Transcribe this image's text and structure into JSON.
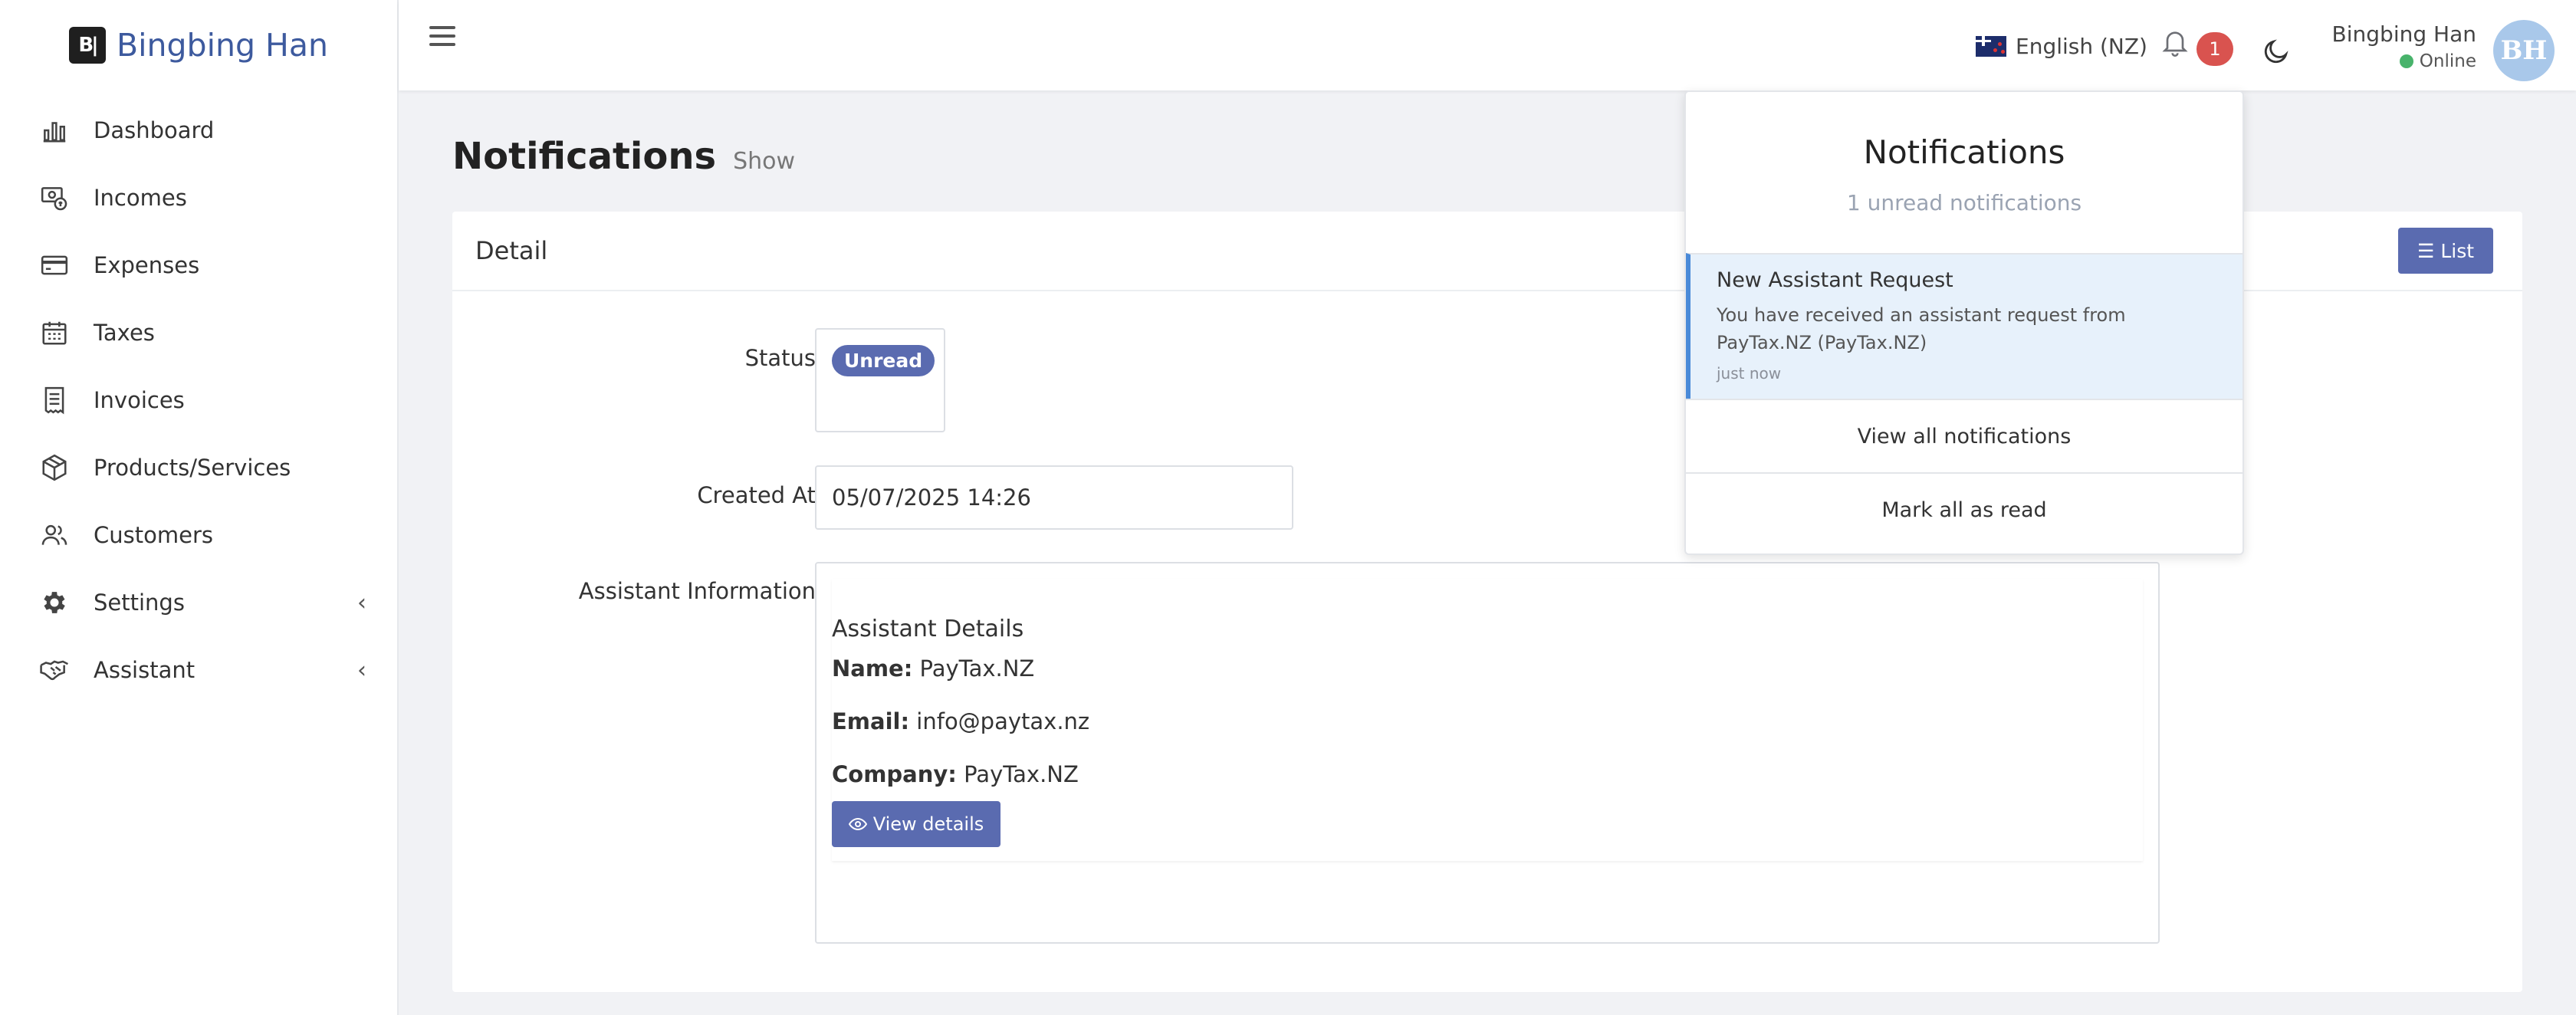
{
  "brand": {
    "name": "Bingbing Han",
    "logo_text": "B|"
  },
  "sidebar": {
    "items": [
      {
        "label": "Dashboard",
        "icon": "bar-chart-icon"
      },
      {
        "label": "Incomes",
        "icon": "money-icon"
      },
      {
        "label": "Expenses",
        "icon": "credit-card-icon"
      },
      {
        "label": "Taxes",
        "icon": "calendar-icon"
      },
      {
        "label": "Invoices",
        "icon": "invoice-icon"
      },
      {
        "label": "Products/Services",
        "icon": "box-icon"
      },
      {
        "label": "Customers",
        "icon": "users-icon"
      },
      {
        "label": "Settings",
        "icon": "gear-icon",
        "chevron": "‹"
      },
      {
        "label": "Assistant",
        "icon": "handshake-icon",
        "chevron": "‹"
      }
    ]
  },
  "topbar": {
    "language": "English (NZ)",
    "notification_count": "1",
    "user_name": "Bingbing Han",
    "user_status": "Online",
    "avatar_initials": "BH"
  },
  "page": {
    "title": "Notifications",
    "subtitle": "Show"
  },
  "card": {
    "header": "Detail",
    "list_button": "List",
    "status_label": "Status",
    "status_value": "Unread",
    "created_label": "Created At",
    "created_value": "05/07/2025 14:26",
    "assistant_label": "Assistant Information",
    "assistant": {
      "title": "Assistant Details",
      "name_label": "Name:",
      "name_value": "PayTax.NZ",
      "email_label": "Email:",
      "email_value": "info@paytax.nz",
      "company_label": "Company:",
      "company_value": "PayTax.NZ",
      "view_button": "View details"
    }
  },
  "notifications": {
    "title": "Notifications",
    "subtitle": "1 unread notifications",
    "items": [
      {
        "title": "New Assistant Request",
        "body": "You have received an assistant request from PayTax.NZ (PayTax.NZ)",
        "time": "just now"
      }
    ],
    "view_all": "View all notifications",
    "mark_all": "Mark all as read"
  },
  "colors": {
    "brand": "#3d5a9e",
    "primary": "#5a6bb0",
    "badge_danger": "#d9534f",
    "online": "#48b36b",
    "highlight": "#e7f1fb"
  }
}
